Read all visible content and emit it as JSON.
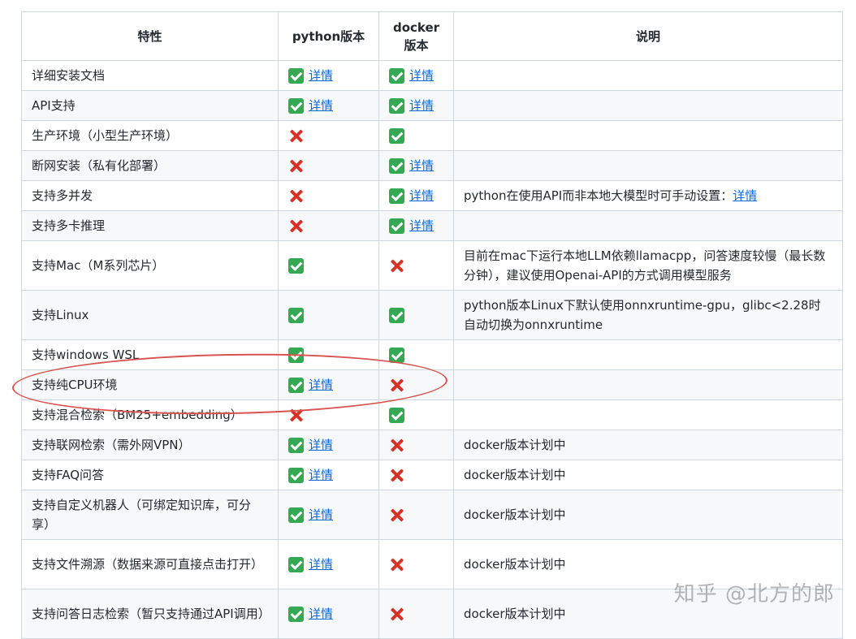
{
  "header": {
    "feature": "特性",
    "python": "python版本",
    "docker_line1": "docker",
    "docker_line2": "版本",
    "note": "说明"
  },
  "link_text": "详情",
  "rows": [
    {
      "feature": "详细安装文档",
      "python": "yes",
      "python_link": "详情",
      "docker": "yes",
      "docker_link": "详情",
      "note": ""
    },
    {
      "feature": "API支持",
      "python": "yes",
      "python_link": "详情",
      "docker": "yes",
      "docker_link": "详情",
      "note": ""
    },
    {
      "feature": "生产环境（小型生产环境）",
      "python": "no",
      "python_link": "",
      "docker": "yes",
      "docker_link": "",
      "note": ""
    },
    {
      "feature": "断网安装（私有化部署）",
      "python": "no",
      "python_link": "",
      "docker": "yes",
      "docker_link": "详情",
      "note": ""
    },
    {
      "feature": "支持多并发",
      "python": "no",
      "python_link": "",
      "docker": "yes",
      "docker_link": "详情",
      "note": "python在使用API而非本地大模型时可手动设置：",
      "note_link": "详情"
    },
    {
      "feature": "支持多卡推理",
      "python": "no",
      "python_link": "",
      "docker": "yes",
      "docker_link": "详情",
      "note": ""
    },
    {
      "feature": "支持Mac（M系列芯片）",
      "python": "yes",
      "python_link": "",
      "docker": "no",
      "docker_link": "",
      "note": "目前在mac下运行本地LLM依赖llamacpp，问答速度较慢（最长数分钟），建议使用Openai-API的方式调用模型服务"
    },
    {
      "feature": "支持Linux",
      "python": "yes",
      "python_link": "",
      "docker": "yes",
      "docker_link": "",
      "note": "python版本Linux下默认使用onnxruntime-gpu，glibc<2.28时自动切换为onnxruntime"
    },
    {
      "feature": "支持windows WSL",
      "python": "yes",
      "python_link": "",
      "docker": "yes",
      "docker_link": "",
      "note": ""
    },
    {
      "feature": "支持纯CPU环境",
      "python": "yes",
      "python_link": "详情",
      "docker": "no",
      "docker_link": "",
      "note": ""
    },
    {
      "feature": "支持混合检索（BM25+embedding）",
      "python": "no",
      "python_link": "",
      "docker": "yes",
      "docker_link": "",
      "note": ""
    },
    {
      "feature": "支持联网检索（需外网VPN）",
      "python": "yes",
      "python_link": "详情",
      "docker": "no",
      "docker_link": "",
      "note": "docker版本计划中"
    },
    {
      "feature": "支持FAQ问答",
      "python": "yes",
      "python_link": "详情",
      "docker": "no",
      "docker_link": "",
      "note": "docker版本计划中"
    },
    {
      "feature": "支持自定义机器人（可绑定知识库，可分享）",
      "python": "yes",
      "python_link": "详情",
      "docker": "no",
      "docker_link": "",
      "note": "docker版本计划中"
    },
    {
      "feature": "支持文件溯源（数据来源可直接点击打开）",
      "python": "yes",
      "python_link": "详情",
      "docker": "no",
      "docker_link": "",
      "note": "docker版本计划中"
    },
    {
      "feature": "支持问答日志检索（暂只支持通过API调用）",
      "python": "yes",
      "python_link": "详情",
      "docker": "no",
      "docker_link": "",
      "note": "docker版本计划中"
    }
  ],
  "watermark": "知乎 @北方的郎",
  "colors": {
    "yes": "#34a853",
    "no": "#d93025",
    "link": "#0969da",
    "highlight_oval": "#d9534f"
  }
}
